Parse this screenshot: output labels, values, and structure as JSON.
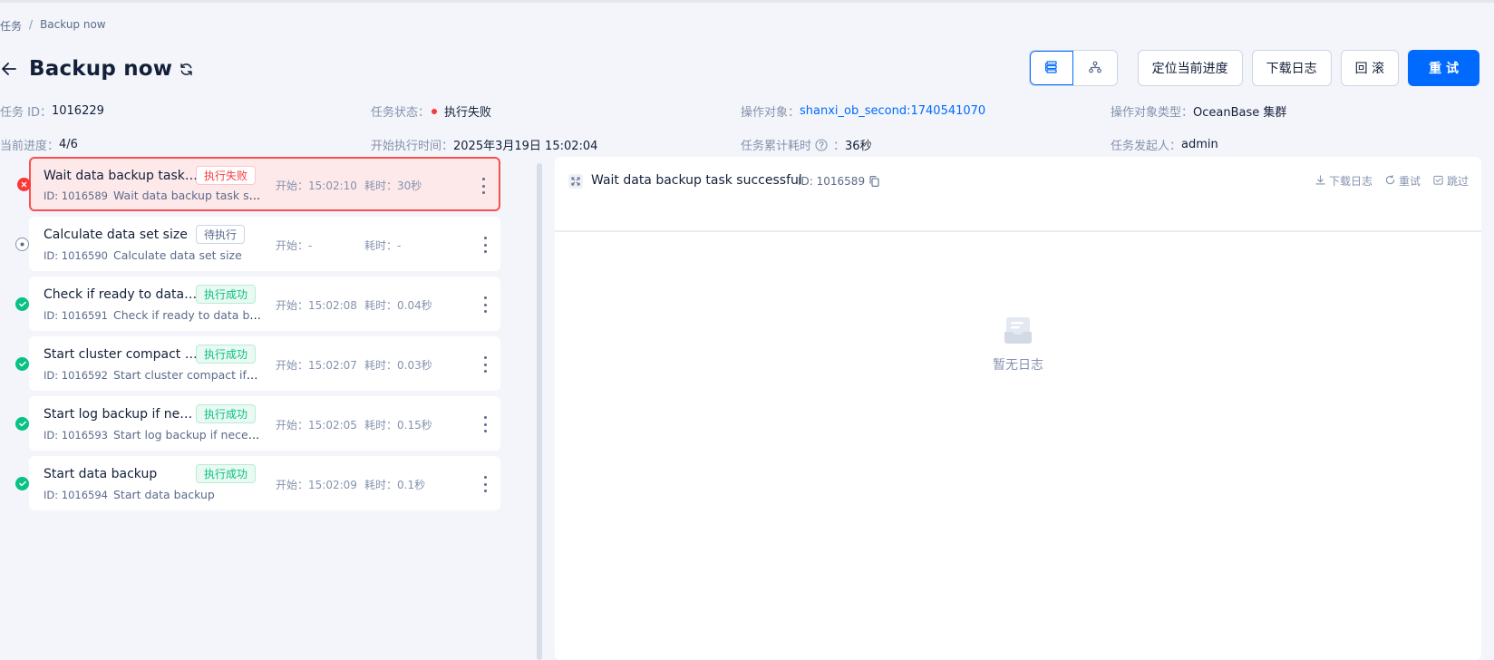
{
  "breadcrumb": {
    "parent": "任务",
    "separator": "/",
    "current": "Backup now"
  },
  "header": {
    "title": "Backup now"
  },
  "toolbar": {
    "locate_progress": "定位当前进度",
    "download_log": "下载日志",
    "rollback": "回 滚",
    "retry": "重 试"
  },
  "info": {
    "task_id_label": "任务 ID：",
    "task_id": "1016229",
    "status_label": "任务状态：",
    "status": "执行失败",
    "target_label": "操作对象：",
    "target": "shanxi_ob_second:1740541070",
    "target_type_label": "操作对象类型：",
    "target_type": "OceanBase 集群",
    "progress_label": "当前进度：",
    "progress": "4/6",
    "start_time_label": "开始执行时间：",
    "start_time": "2025年3月19日 15:02:04",
    "elapsed_label": "任务累计耗时",
    "elapsed": "36秒",
    "initiator_label": "任务发起人：",
    "initiator": "admin"
  },
  "colors": {
    "accent": "#006aff",
    "fail": "#f93939",
    "success": "#0ac185"
  },
  "tasks": [
    {
      "title": "Wait data backup task successful",
      "status": "fail",
      "tag": "执行失败",
      "id": "ID: 1016589",
      "desc": "Wait data backup task successful",
      "start": "开始：15:02:10",
      "duration": "耗时：30秒"
    },
    {
      "title": "Calculate data set size",
      "status": "pending",
      "tag": "待执行",
      "id": "ID: 1016590",
      "desc": "Calculate data set size",
      "start": "开始：-",
      "duration": "耗时：-"
    },
    {
      "title": "Check if ready to data backup",
      "status": "success",
      "tag": "执行成功",
      "id": "ID: 1016591",
      "desc": "Check if ready to data backup",
      "start": "开始：15:02:08",
      "duration": "耗时：0.04秒"
    },
    {
      "title": "Start cluster compact if needed",
      "status": "success",
      "tag": "执行成功",
      "id": "ID: 1016592",
      "desc": "Start cluster compact if needed",
      "start": "开始：15:02:07",
      "duration": "耗时：0.03秒"
    },
    {
      "title": "Start log backup if necessary",
      "status": "success",
      "tag": "执行成功",
      "id": "ID: 1016593",
      "desc": "Start log backup if necessary",
      "start": "开始：15:02:05",
      "duration": "耗时：0.15秒"
    },
    {
      "title": "Start data backup",
      "status": "success",
      "tag": "执行成功",
      "id": "ID: 1016594",
      "desc": "Start data backup",
      "start": "开始：15:02:09",
      "duration": "耗时：0.1秒"
    }
  ],
  "log_panel": {
    "title": "Wait data backup task successful",
    "id": "ID: 1016589",
    "download": "下载日志",
    "retry": "重试",
    "skip": "跳过",
    "empty": "暂无日志"
  }
}
